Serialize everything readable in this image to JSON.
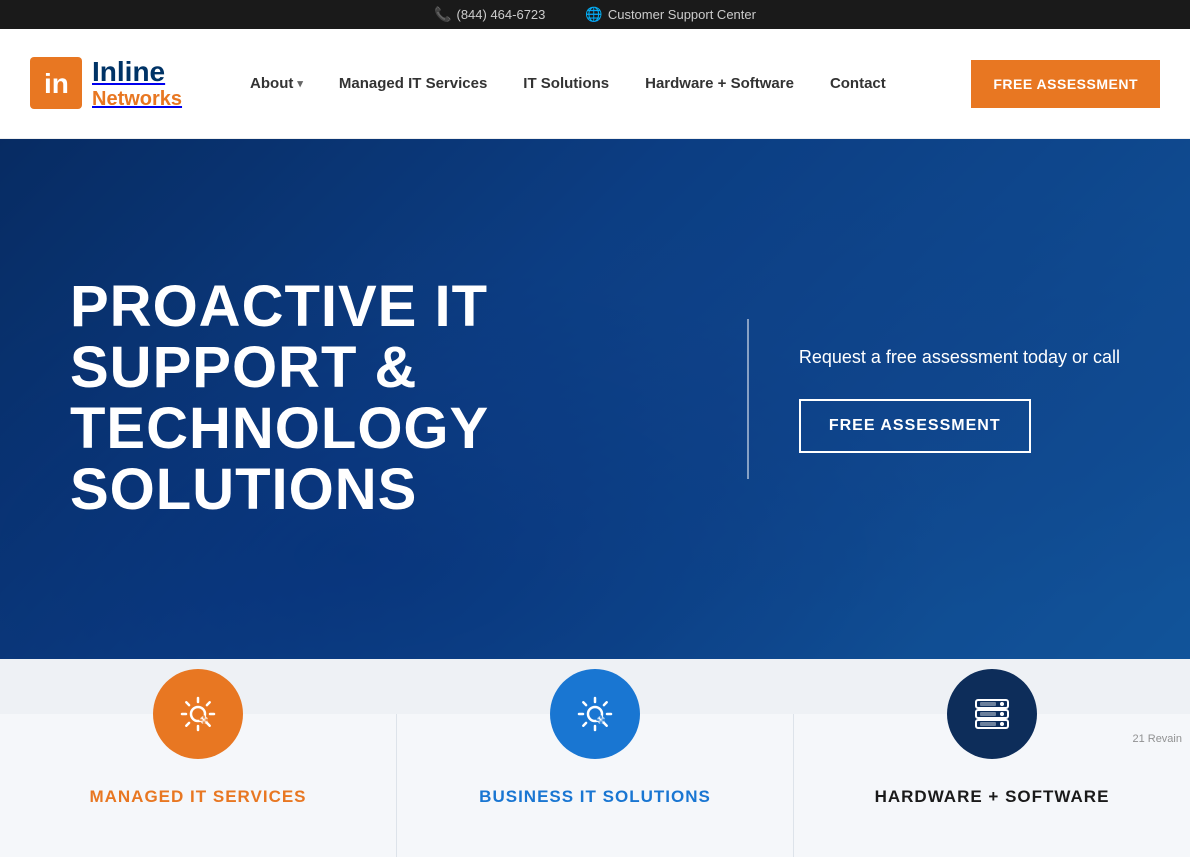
{
  "topbar": {
    "phone": "(844) 464-6723",
    "support_text": "Customer Support Center"
  },
  "nav": {
    "logo_inline": "Inline",
    "logo_networks": "Networks",
    "links": [
      {
        "label": "About",
        "has_dropdown": true
      },
      {
        "label": "Managed IT Services",
        "has_dropdown": false
      },
      {
        "label": "IT Solutions",
        "has_dropdown": false
      },
      {
        "label": "Hardware + Software",
        "has_dropdown": false
      },
      {
        "label": "Contact",
        "has_dropdown": false
      }
    ],
    "cta_label": "FREE ASSESSMENT"
  },
  "hero": {
    "title_line1": "PROACTIVE IT SUPPORT &",
    "title_line2": "TECHNOLOGY SOLUTIONS",
    "request_text": "Request a free assessment today or call",
    "cta_label": "FREE ASSESSMENT"
  },
  "cards": [
    {
      "icon_type": "gear-orange",
      "title": "MANAGED IT SERVICES",
      "title_color": "orange"
    },
    {
      "icon_type": "gear-blue",
      "title": "BUSINESS IT SOLUTIONS",
      "title_color": "blue"
    },
    {
      "icon_type": "server-darkblue",
      "title": "HARDWARE + SOFTWARE",
      "title_color": "dark"
    }
  ],
  "watermark": {
    "label": "21 Revain"
  }
}
